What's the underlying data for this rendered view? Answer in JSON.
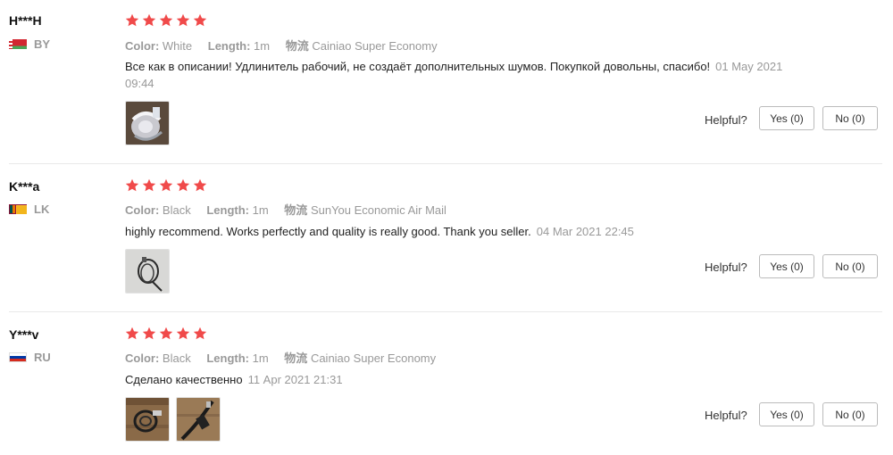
{
  "helpful_label": "Helpful?",
  "colors": {
    "star": "#f04a4a",
    "divider": "#e8e8e8",
    "muted": "#999999"
  },
  "reviews": [
    {
      "user": "H***H",
      "country": "BY",
      "flag": "belarus-flag",
      "rating": 5,
      "color_label": "Color:",
      "color_value": "White",
      "length_label": "Length:",
      "length_value": "1m",
      "shipping_label": "物流",
      "shipping_value": "Cainiao Super Economy",
      "text": "Все как в описании! Удлинитель рабочий, не создаёт дополнительных шумов. Покупкой довольны, спасибо!",
      "date": "01 May 2021 09:44",
      "photos": [
        "usb-cable-coil-photo"
      ],
      "yes": "Yes (0)",
      "no": "No (0)"
    },
    {
      "user": "K***a",
      "country": "LK",
      "flag": "sri-lanka-flag",
      "rating": 5,
      "color_label": "Color:",
      "color_value": "Black",
      "length_label": "Length:",
      "length_value": "1m",
      "shipping_label": "物流",
      "shipping_value": "SunYou Economic Air Mail",
      "text": "highly recommend. Works perfectly and quality is really good. Thank you seller.",
      "date": "04 Mar 2021 22:45",
      "photos": [
        "black-cable-photo"
      ],
      "yes": "Yes (0)",
      "no": "No (0)"
    },
    {
      "user": "Y***v",
      "country": "RU",
      "flag": "russia-flag",
      "rating": 5,
      "color_label": "Color:",
      "color_value": "Black",
      "length_label": "Length:",
      "length_value": "1m",
      "shipping_label": "物流",
      "shipping_value": "Cainiao Super Economy",
      "text": "Сделано качественно",
      "date": "11 Apr 2021 21:31",
      "photos": [
        "cable-on-wood-photo",
        "cable-plug-photo"
      ],
      "yes": "Yes (0)",
      "no": "No (0)"
    }
  ]
}
